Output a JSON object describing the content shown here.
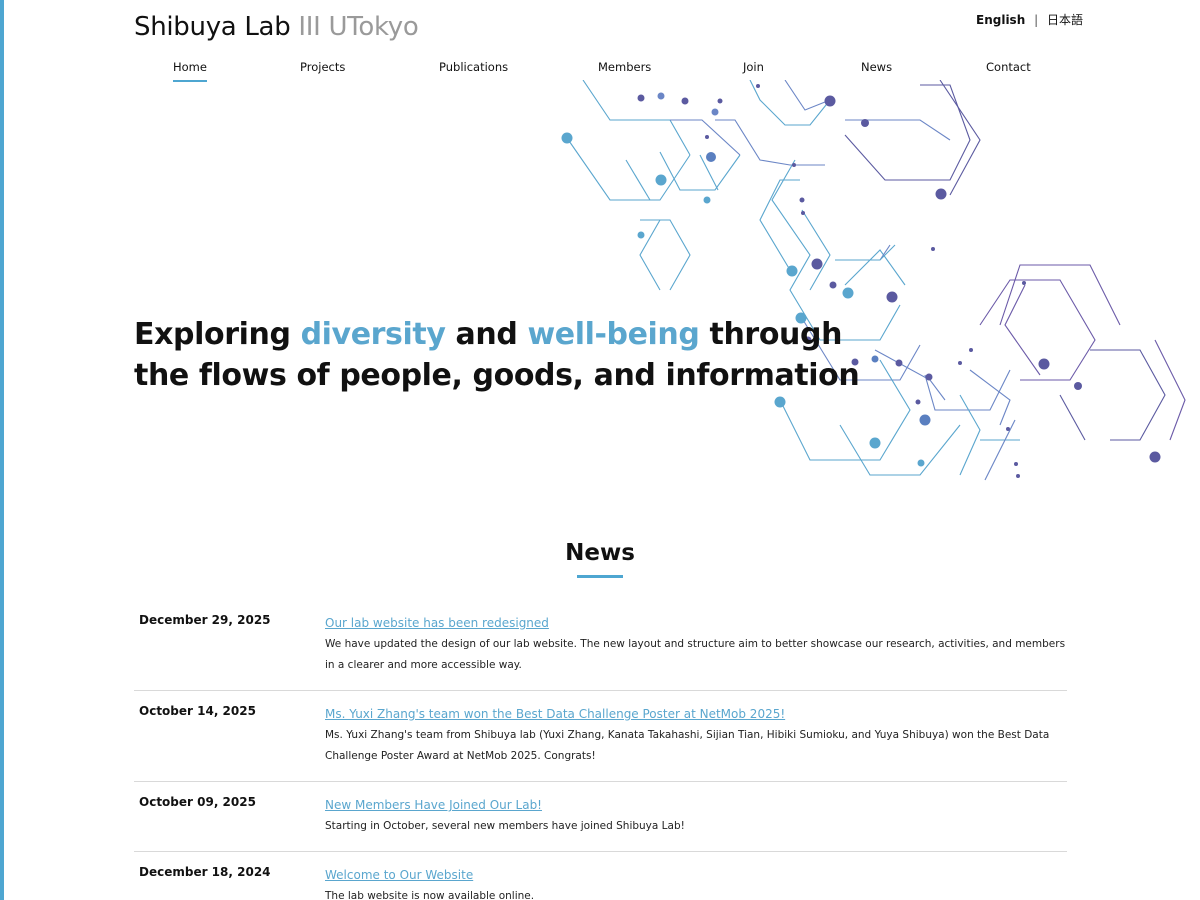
{
  "brand": {
    "main": "Shibuya Lab",
    "sub": "III UTokyo"
  },
  "language": {
    "english": "English",
    "separator": "|",
    "japanese": "日本語"
  },
  "nav": {
    "items": [
      {
        "label": "Home",
        "active": true
      },
      {
        "label": "Projects"
      },
      {
        "label": "Publications"
      },
      {
        "label": "Members"
      },
      {
        "label": "Join"
      },
      {
        "label": "News"
      },
      {
        "label": "Contact"
      }
    ]
  },
  "hero": {
    "line1_a": "Exploring ",
    "line1_b": "diversity",
    "line1_c": " and ",
    "line1_d": "well-being",
    "line1_e": " through",
    "line2": "the flows of people, goods, and information"
  },
  "news": {
    "heading": "News",
    "items": [
      {
        "date": "December 29, 2025",
        "title": "Our lab website has been redesigned",
        "text": "We have updated the design of our lab website. The new layout and structure aim to better showcase our research, activities, and members in a clearer and more accessible way."
      },
      {
        "date": "October 14, 2025",
        "title": "Ms. Yuxi Zhang's team won the Best Data Challenge Poster at NetMob 2025!",
        "text": "Ms. Yuxi Zhang's team from Shibuya lab (Yuxi Zhang, Kanata Takahashi, Sijian Tian, Hibiki Sumioku, and Yuya Shibuya) won the Best Data Challenge Poster Award at NetMob 2025. Congrats!"
      },
      {
        "date": "October 09, 2025",
        "title": "New Members Have Joined Our Lab!",
        "text": "Starting in October, several new members have joined Shibuya Lab!"
      },
      {
        "date": "December 18, 2024",
        "title": "Welcome to Our Website",
        "text": "The lab website is now available online."
      }
    ]
  },
  "colors": {
    "accent": "#4ea6d1",
    "accent_text": "#5aa6ce",
    "purple": "#5b5aa0"
  }
}
